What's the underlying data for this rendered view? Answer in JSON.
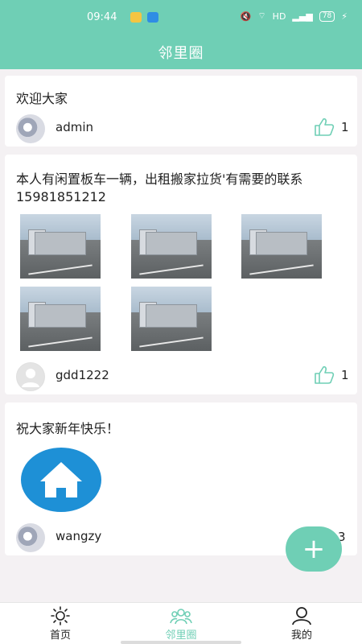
{
  "status_bar": {
    "time": "09:44",
    "network": "HD",
    "battery": "78"
  },
  "header": {
    "title": "邻里圈"
  },
  "posts": [
    {
      "text": "欢迎大家",
      "user": "admin",
      "likes": "1"
    },
    {
      "text": "本人有闲置板车一辆，出租搬家拉货'有需要的联系15981851212",
      "user": "gdd1222",
      "likes": "1"
    },
    {
      "text": "祝大家新年快乐！",
      "user": "wangzy",
      "likes": "3"
    }
  ],
  "nav": [
    {
      "label": "首页",
      "icon": "sun-icon"
    },
    {
      "label": "邻里圈",
      "icon": "group-icon",
      "active": true
    },
    {
      "label": "我的",
      "icon": "user-icon"
    }
  ],
  "colors": {
    "accent": "#6fcfb5",
    "home_icon_bg": "#1e90d6"
  }
}
